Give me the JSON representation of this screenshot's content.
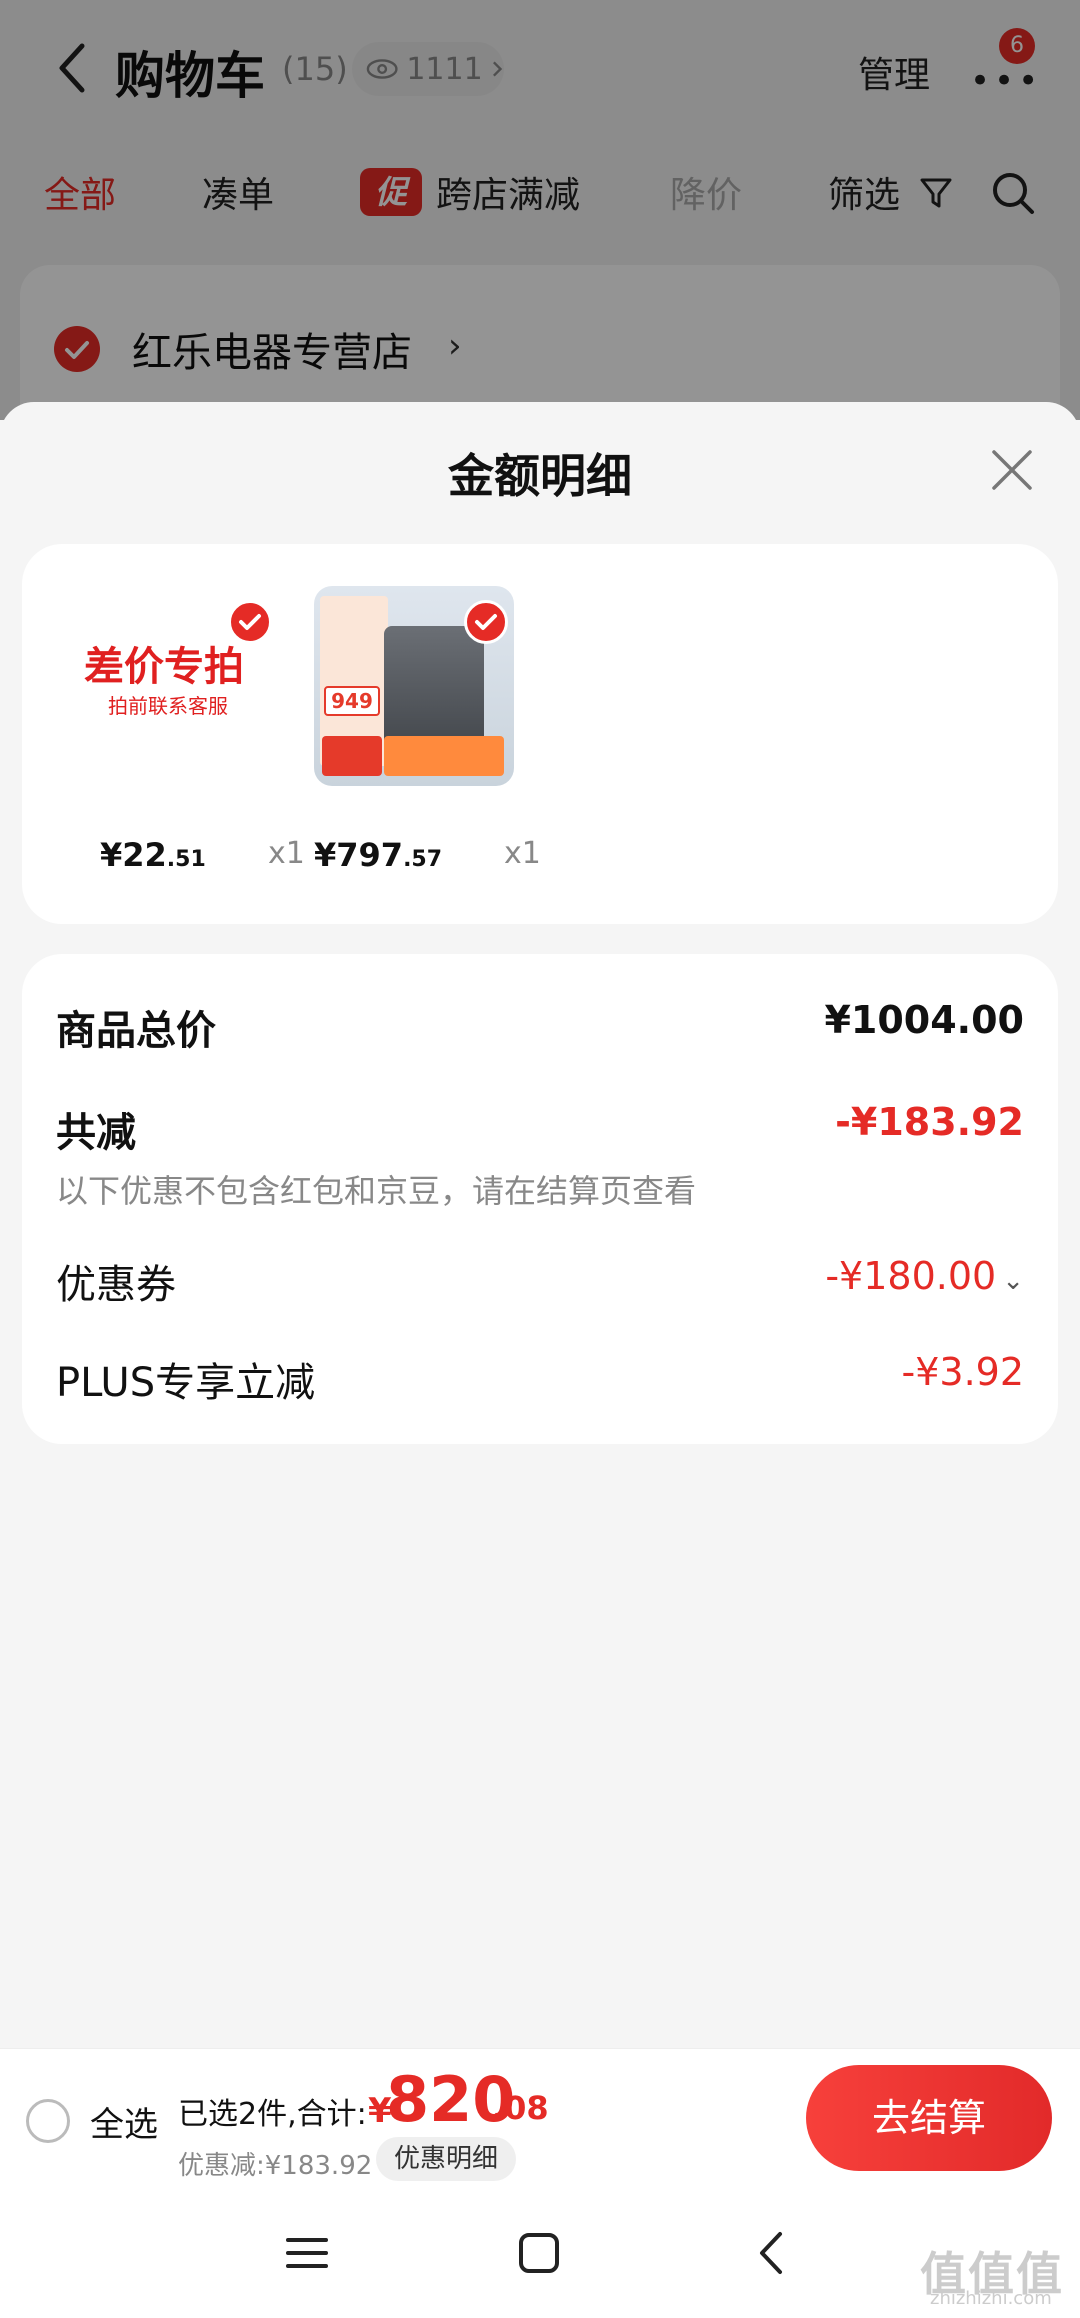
{
  "header": {
    "title": "购物车",
    "count": "(15)",
    "views": "1111",
    "manage_label": "管理",
    "notification_badge": "6"
  },
  "filters": {
    "all": "全部",
    "bundle": "凑单",
    "promo_tag": "促",
    "cross_store": "跨店满减",
    "price_drop": "降价",
    "filter": "筛选"
  },
  "store": {
    "name": "红乐电器专营店"
  },
  "sheet": {
    "title": "金额明细",
    "items": [
      {
        "thumb_title": "差价专拍",
        "thumb_sub": "拍前联系客服",
        "price_int": "¥22",
        "price_dec": ".51",
        "qty": "x1"
      },
      {
        "thumb_price": "949",
        "price_int": "¥797",
        "price_dec": ".57",
        "qty": "x1"
      }
    ],
    "summary": {
      "total_label": "商品总价",
      "total_value": "¥1004.00",
      "reduce_label": "共减",
      "reduce_value": "-¥183.92",
      "note": "以下优惠不包含红包和京豆，请在结算页查看",
      "coupon_label": "优惠券",
      "coupon_value": "-¥180.00",
      "plus_label": "PLUS专享立减",
      "plus_value": "-¥3.92"
    }
  },
  "checkout": {
    "select_all": "全选",
    "selected_text": "已选2件,合计:",
    "total_symbol": "¥",
    "total_int": "820",
    "total_dec": ".08",
    "discount_text": "优惠减:¥183.92",
    "detail_chip": "优惠明细",
    "pay_button": "去结算"
  },
  "watermark": {
    "main": "值值值",
    "sub": "zhizhizhi.com"
  },
  "colors": {
    "accent": "#e52b26",
    "background": "#f5f5f5"
  }
}
